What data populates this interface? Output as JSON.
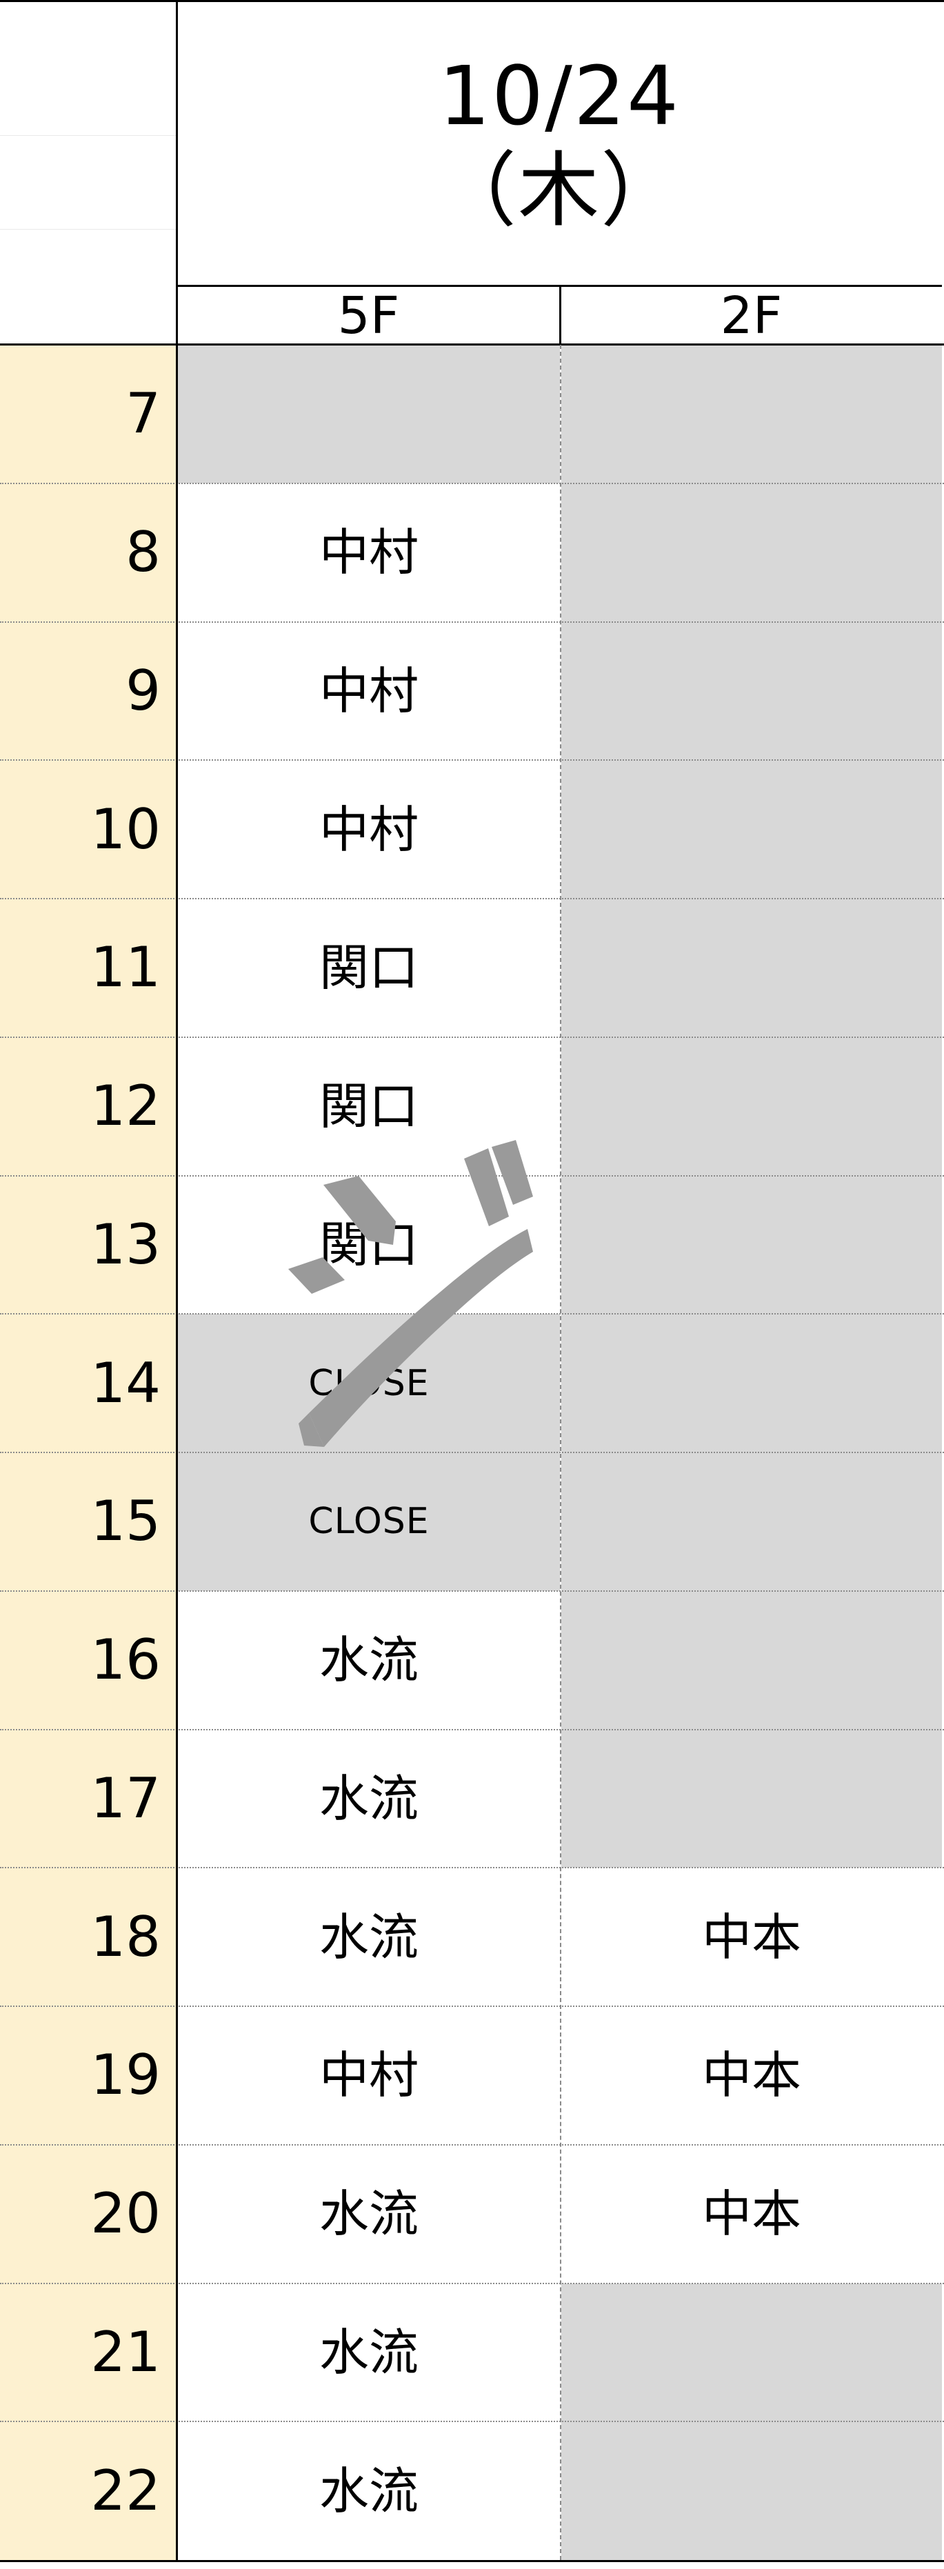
{
  "header": {
    "date": "10/24",
    "weekday": "（木）",
    "columns": [
      "5F",
      "2F"
    ]
  },
  "colors": {
    "hour_column_bg": "#FDF1D0",
    "unavailable_bg": "#D8D8D8",
    "available_bg": "#FFFFFF",
    "text": "#000000",
    "annotation": "#9A9A9A",
    "grid_solid": "#000000",
    "grid_dotted": "#8A8A8A"
  },
  "schedule": {
    "row_labels": [
      "7",
      "8",
      "9",
      "10",
      "11",
      "12",
      "13",
      "14",
      "15",
      "16",
      "17",
      "18",
      "19",
      "20",
      "21",
      "22"
    ],
    "rows": [
      {
        "hour": "7",
        "f5": "",
        "f5_state": "unavailable",
        "f2": "",
        "f2_state": "unavailable"
      },
      {
        "hour": "8",
        "f5": "中村",
        "f5_state": "booked",
        "f2": "",
        "f2_state": "unavailable"
      },
      {
        "hour": "9",
        "f5": "中村",
        "f5_state": "booked",
        "f2": "",
        "f2_state": "unavailable"
      },
      {
        "hour": "10",
        "f5": "中村",
        "f5_state": "booked",
        "f2": "",
        "f2_state": "unavailable"
      },
      {
        "hour": "11",
        "f5": "関口",
        "f5_state": "booked",
        "f2": "",
        "f2_state": "unavailable"
      },
      {
        "hour": "12",
        "f5": "関口",
        "f5_state": "booked",
        "f2": "",
        "f2_state": "unavailable"
      },
      {
        "hour": "13",
        "f5": "関口",
        "f5_state": "booked",
        "f2": "",
        "f2_state": "unavailable"
      },
      {
        "hour": "14",
        "f5": "CLOSE",
        "f5_state": "closed",
        "f2": "",
        "f2_state": "unavailable"
      },
      {
        "hour": "15",
        "f5": "CLOSE",
        "f5_state": "closed",
        "f2": "",
        "f2_state": "unavailable"
      },
      {
        "hour": "16",
        "f5": "水流",
        "f5_state": "booked",
        "f2": "",
        "f2_state": "unavailable"
      },
      {
        "hour": "17",
        "f5": "水流",
        "f5_state": "booked",
        "f2": "",
        "f2_state": "unavailable"
      },
      {
        "hour": "18",
        "f5": "水流",
        "f5_state": "booked",
        "f2": "中本",
        "f2_state": "booked"
      },
      {
        "hour": "19",
        "f5": "中村",
        "f5_state": "booked",
        "f2": "中本",
        "f2_state": "booked"
      },
      {
        "hour": "20",
        "f5": "水流",
        "f5_state": "booked",
        "f2": "中本",
        "f2_state": "booked"
      },
      {
        "hour": "21",
        "f5": "水流",
        "f5_state": "booked",
        "f2": "",
        "f2_state": "unavailable"
      },
      {
        "hour": "22",
        "f5": "水流",
        "f5_state": "booked",
        "f2": "",
        "f2_state": "unavailable"
      }
    ]
  },
  "annotation": {
    "label": "handwritten-gray-marker",
    "description": "gray marker strokes over rows 12-14 and a horizontal bar struck through hour 13"
  }
}
